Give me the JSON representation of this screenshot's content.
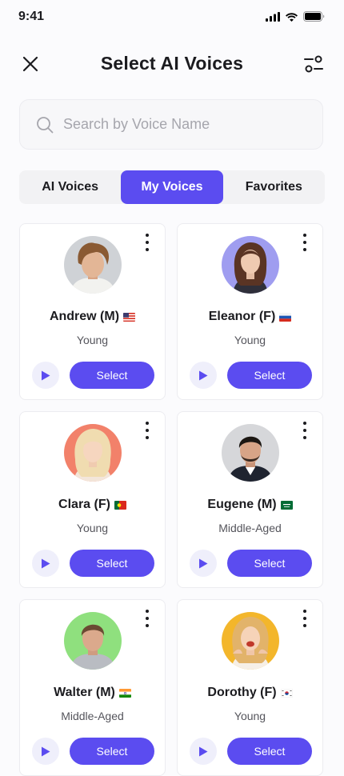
{
  "status_bar": {
    "time": "9:41"
  },
  "header": {
    "title": "Select AI Voices"
  },
  "search": {
    "placeholder": "Search by Voice Name",
    "value": ""
  },
  "tabs": [
    {
      "label": "AI Voices",
      "active": false
    },
    {
      "label": "My Voices",
      "active": true
    },
    {
      "label": "Favorites",
      "active": false
    }
  ],
  "colors": {
    "accent": "#5b4cf0",
    "play_bg": "#efeffb"
  },
  "voices": [
    {
      "name": "Andrew (M)",
      "flag": "us-flag",
      "age": "Young",
      "action": "Select"
    },
    {
      "name": "Eleanor (F)",
      "flag": "ru-flag",
      "age": "Young",
      "action": "Select"
    },
    {
      "name": "Clara (F)",
      "flag": "pt-flag",
      "age": "Young",
      "action": "Select"
    },
    {
      "name": "Eugene (M)",
      "flag": "sa-flag",
      "age": "Middle-Aged",
      "action": "Select"
    },
    {
      "name": "Walter (M)",
      "flag": "in-flag",
      "age": "Middle-Aged",
      "action": "Select"
    },
    {
      "name": "Dorothy (F)",
      "flag": "kr-flag",
      "age": "Young",
      "action": "Select"
    }
  ]
}
